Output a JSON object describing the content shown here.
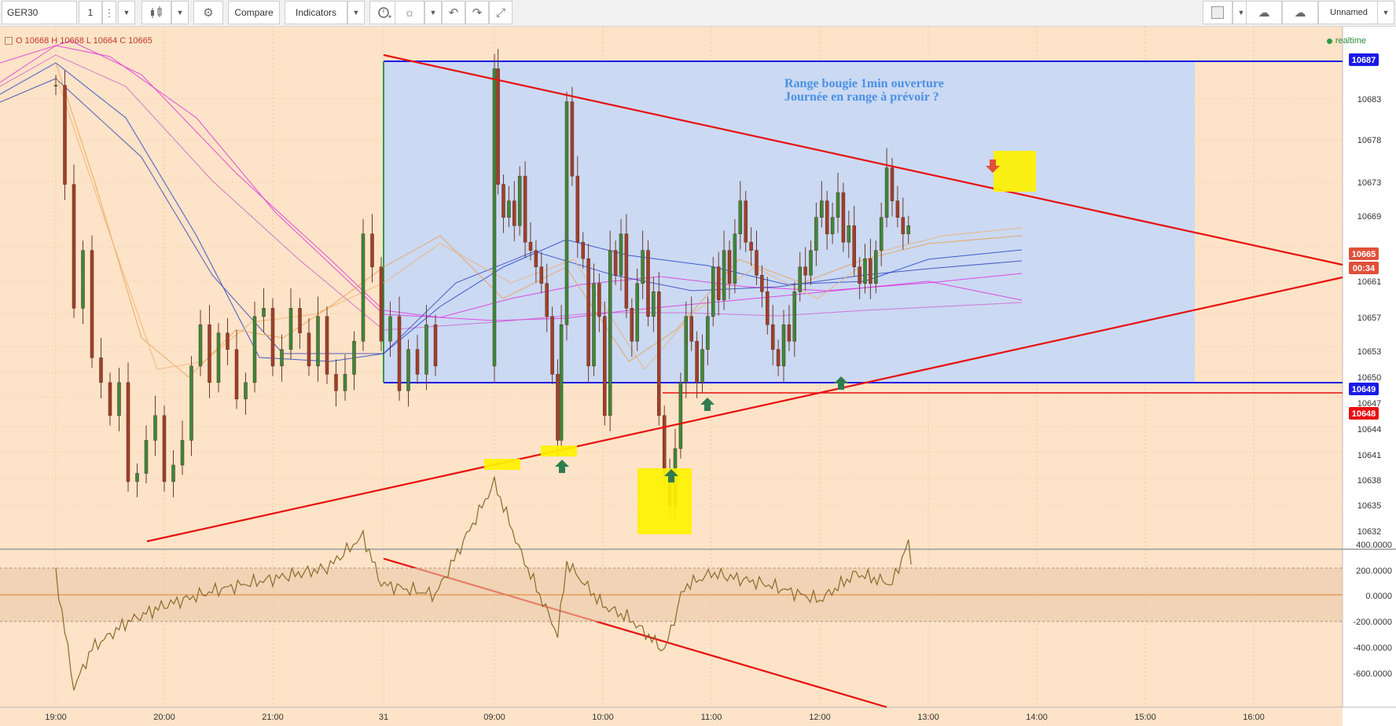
{
  "toolbar": {
    "symbol": "GER30",
    "interval": "1",
    "compare_label": "Compare",
    "indicators_label": "Indicators",
    "layout_name": "Unnamed",
    "icons": [
      "candles-icon",
      "settings-icon",
      "alert-icon",
      "ideas-icon",
      "undo-icon",
      "redo-icon",
      "fullscreen-icon",
      "color-swatch-icon",
      "cloud-load-icon",
      "cloud-save-icon"
    ]
  },
  "legend": {
    "symbol_ohlc": "O 10668 H 10668 L 10664 C 10665",
    "realtime": "realtime"
  },
  "annotation": {
    "line1": "Range bougie 1min ouverture",
    "line2": "Journée en range à prévoir ?"
  },
  "price_scale": {
    "ticks": [
      "10683",
      "10678",
      "10673",
      "10669",
      "10661",
      "10657",
      "10653",
      "10650",
      "10647",
      "10644",
      "10641",
      "10638",
      "10635",
      "10632"
    ],
    "badges": [
      {
        "value": "10687",
        "color": "#1a1ae6"
      },
      {
        "value": "10665",
        "color": "#e0503a"
      },
      {
        "value": "00:34",
        "color": "#e0503a"
      },
      {
        "value": "10649",
        "color": "#1a1ae6"
      },
      {
        "value": "10648",
        "color": "#e81010"
      }
    ]
  },
  "oscillator_scale": {
    "ticks": [
      "400.0000",
      "200.0000",
      "0.0000",
      "-200.0000",
      "-400.0000",
      "-600.0000"
    ]
  },
  "time_axis": {
    "labels": [
      "19:00",
      "20:00",
      "21:00",
      "31",
      "09:00",
      "10:00",
      "11:00",
      "12:00",
      "13:00",
      "14:00",
      "15:00",
      "16:00"
    ]
  },
  "colors": {
    "background": "#fde3c7",
    "range_box": "#c8d8f5",
    "range_line": "#1a1ae6",
    "trend_line": "#e81010",
    "highlight": "#fff200",
    "arrow_up": "#2e7d4f",
    "arrow_down": "#e0503a"
  },
  "chart_data": {
    "type": "candlestick",
    "symbol": "GER30",
    "ylim": [
      10629,
      10692
    ],
    "oscillator_ylim": [
      -650,
      450
    ],
    "range_box": {
      "top": 10687,
      "bottom": 10649
    },
    "support_line": 10648,
    "close_path": [
      [
        "19:00",
        10684
      ],
      [
        "19:05",
        10672
      ],
      [
        "19:10",
        10657
      ],
      [
        "19:15",
        10664
      ],
      [
        "19:20",
        10651
      ],
      [
        "19:25",
        10648
      ],
      [
        "19:30",
        10644
      ],
      [
        "19:35",
        10648
      ],
      [
        "19:40",
        10636
      ],
      [
        "19:45",
        10637
      ],
      [
        "19:50",
        10641
      ],
      [
        "19:55",
        10644
      ],
      [
        "20:00",
        10636
      ],
      [
        "20:05",
        10638
      ],
      [
        "20:10",
        10641
      ],
      [
        "20:15",
        10650
      ],
      [
        "20:20",
        10655
      ],
      [
        "20:25",
        10648
      ],
      [
        "20:30",
        10654
      ],
      [
        "20:35",
        10652
      ],
      [
        "20:40",
        10646
      ],
      [
        "20:45",
        10648
      ],
      [
        "20:50",
        10656
      ],
      [
        "20:55",
        10657
      ],
      [
        "21:00",
        10650
      ],
      [
        "21:05",
        10652
      ],
      [
        "21:10",
        10657
      ],
      [
        "21:15",
        10654
      ],
      [
        "21:20",
        10650
      ],
      [
        "21:25",
        10656
      ],
      [
        "21:30",
        10649
      ],
      [
        "21:35",
        10647
      ],
      [
        "21:40",
        10649
      ],
      [
        "21:45",
        10653
      ],
      [
        "21:50",
        10666
      ],
      [
        "21:55",
        10662
      ],
      [
        "22:00",
        10653
      ],
      [
        "22:05",
        10656
      ],
      [
        "22:10",
        10647
      ],
      [
        "22:15",
        10652
      ],
      [
        "22:20",
        10649
      ],
      [
        "22:25",
        10655
      ],
      [
        "22:30",
        10650
      ],
      [
        "09:00",
        10686
      ],
      [
        "09:02",
        10672
      ],
      [
        "09:05",
        10668
      ],
      [
        "09:08",
        10670
      ],
      [
        "09:11",
        10667
      ],
      [
        "09:14",
        10673
      ],
      [
        "09:17",
        10665
      ],
      [
        "09:20",
        10664
      ],
      [
        "09:23",
        10662
      ],
      [
        "09:26",
        10660
      ],
      [
        "09:29",
        10656
      ],
      [
        "09:32",
        10649
      ],
      [
        "09:35",
        10641
      ],
      [
        "09:37",
        10655
      ],
      [
        "09:40",
        10682
      ],
      [
        "09:43",
        10673
      ],
      [
        "09:46",
        10665
      ],
      [
        "09:49",
        10663
      ],
      [
        "09:52",
        10650
      ],
      [
        "09:55",
        10660
      ],
      [
        "09:58",
        10656
      ],
      [
        "10:01",
        10644
      ],
      [
        "10:04",
        10664
      ],
      [
        "10:07",
        10661
      ],
      [
        "10:10",
        10666
      ],
      [
        "10:13",
        10657
      ],
      [
        "10:16",
        10653
      ],
      [
        "10:19",
        10660
      ],
      [
        "10:22",
        10664
      ],
      [
        "10:25",
        10656
      ],
      [
        "10:28",
        10659
      ],
      [
        "10:31",
        10644
      ],
      [
        "10:34",
        10637
      ],
      [
        "10:37",
        10633
      ],
      [
        "10:40",
        10640
      ],
      [
        "10:43",
        10648
      ],
      [
        "10:46",
        10656
      ],
      [
        "10:49",
        10653
      ],
      [
        "10:52",
        10648
      ],
      [
        "10:55",
        10652
      ],
      [
        "10:58",
        10656
      ],
      [
        "11:01",
        10662
      ],
      [
        "11:04",
        10658
      ],
      [
        "11:07",
        10664
      ],
      [
        "11:10",
        10660
      ],
      [
        "11:13",
        10666
      ],
      [
        "11:16",
        10670
      ],
      [
        "11:19",
        10665
      ],
      [
        "11:22",
        10664
      ],
      [
        "11:25",
        10661
      ],
      [
        "11:28",
        10659
      ],
      [
        "11:31",
        10655
      ],
      [
        "11:34",
        10652
      ],
      [
        "11:37",
        10650
      ],
      [
        "11:40",
        10655
      ],
      [
        "11:43",
        10653
      ],
      [
        "11:46",
        10659
      ],
      [
        "11:49",
        10662
      ],
      [
        "11:52",
        10661
      ],
      [
        "11:55",
        10664
      ],
      [
        "11:58",
        10668
      ],
      [
        "12:01",
        10670
      ],
      [
        "12:04",
        10666
      ],
      [
        "12:07",
        10668
      ],
      [
        "12:10",
        10671
      ],
      [
        "12:13",
        10665
      ],
      [
        "12:16",
        10667
      ],
      [
        "12:19",
        10662
      ],
      [
        "12:22",
        10660
      ],
      [
        "12:25",
        10663
      ],
      [
        "12:28",
        10660
      ],
      [
        "12:31",
        10664
      ],
      [
        "12:34",
        10668
      ],
      [
        "12:37",
        10674
      ],
      [
        "12:40",
        10670
      ],
      [
        "12:43",
        10668
      ],
      [
        "12:46",
        10666
      ],
      [
        "12:49",
        10667
      ]
    ],
    "oscillator_path": [
      [
        "19:00",
        80
      ],
      [
        "19:10",
        -350
      ],
      [
        "19:20",
        -200
      ],
      [
        "19:40",
        -100
      ],
      [
        "20:00",
        -40
      ],
      [
        "20:30",
        20
      ],
      [
        "21:00",
        60
      ],
      [
        "21:30",
        100
      ],
      [
        "21:50",
        220
      ],
      [
        "22:00",
        40
      ],
      [
        "22:30",
        0
      ],
      [
        "09:00",
        420
      ],
      [
        "09:15",
        150
      ],
      [
        "09:35",
        -150
      ],
      [
        "09:40",
        120
      ],
      [
        "10:00",
        -40
      ],
      [
        "10:15",
        -90
      ],
      [
        "10:34",
        -210
      ],
      [
        "10:45",
        30
      ],
      [
        "11:00",
        80
      ],
      [
        "11:30",
        40
      ],
      [
        "12:00",
        -20
      ],
      [
        "12:20",
        80
      ],
      [
        "12:40",
        40
      ],
      [
        "12:49",
        200
      ],
      [
        "12:52",
        20
      ]
    ],
    "oscillator_band": [
      -100,
      100
    ]
  }
}
